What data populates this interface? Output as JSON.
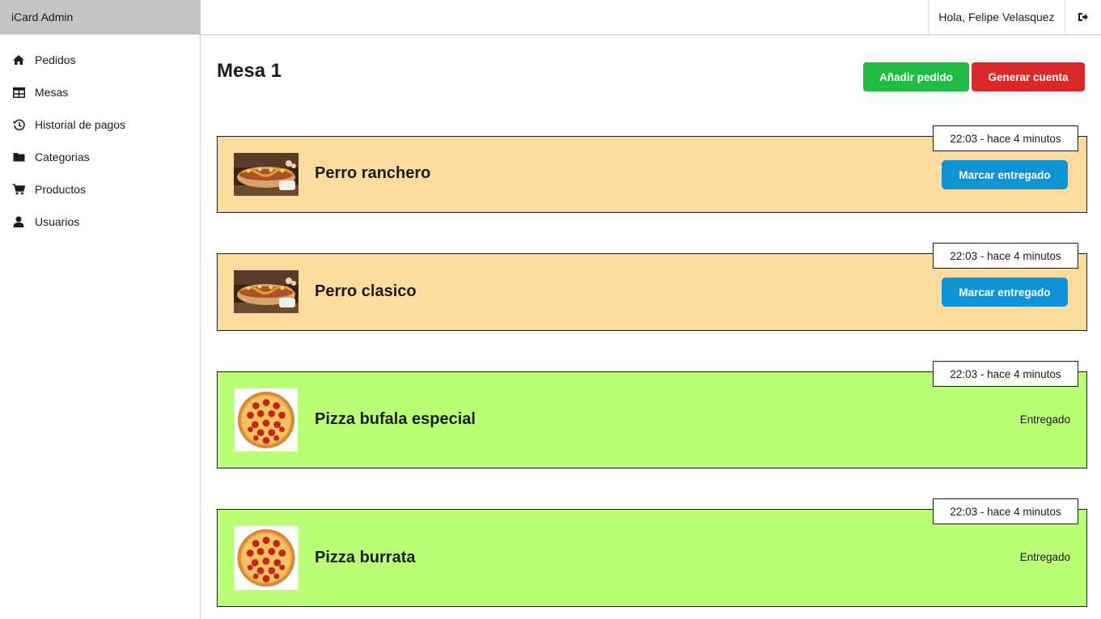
{
  "app": {
    "brand": "iCard Admin"
  },
  "header": {
    "greeting": "Hola, Felipe Velasquez",
    "logout_icon": "sign-out-icon"
  },
  "sidebar": {
    "items": [
      {
        "label": "Pedidos",
        "icon": "home-icon"
      },
      {
        "label": "Mesas",
        "icon": "table-icon"
      },
      {
        "label": "Historial de pagos",
        "icon": "history-icon"
      },
      {
        "label": "Categorias",
        "icon": "folder-icon"
      },
      {
        "label": "Productos",
        "icon": "cart-icon"
      },
      {
        "label": "Usuarios",
        "icon": "user-icon"
      }
    ]
  },
  "main": {
    "title": "Mesa 1",
    "add_order_label": "Añadir pedido",
    "generate_bill_label": "Generar cuenta"
  },
  "orders": [
    {
      "name": "Perro ranchero",
      "time": "22:03 - hace 4 minutos",
      "status": "pending",
      "action_label": "Marcar entregado",
      "image": "hotdog-image"
    },
    {
      "name": "Perro clasico",
      "time": "22:03 - hace 4 minutos",
      "status": "pending",
      "action_label": "Marcar entregado",
      "image": "hotdog-image"
    },
    {
      "name": "Pizza bufala especial",
      "time": "22:03 - hace 4 minutos",
      "status": "delivered",
      "status_label": "Entregado",
      "image": "pizza-image"
    },
    {
      "name": "Pizza burrata",
      "time": "22:03 - hace 4 minutos",
      "status": "delivered",
      "status_label": "Entregado",
      "image": "pizza-image"
    }
  ],
  "colors": {
    "pending_bg": "#fedb9f",
    "delivered_bg": "#baff75",
    "add_button": "#21ba45",
    "bill_button": "#db2828",
    "deliver_button": "#0d93d6"
  }
}
